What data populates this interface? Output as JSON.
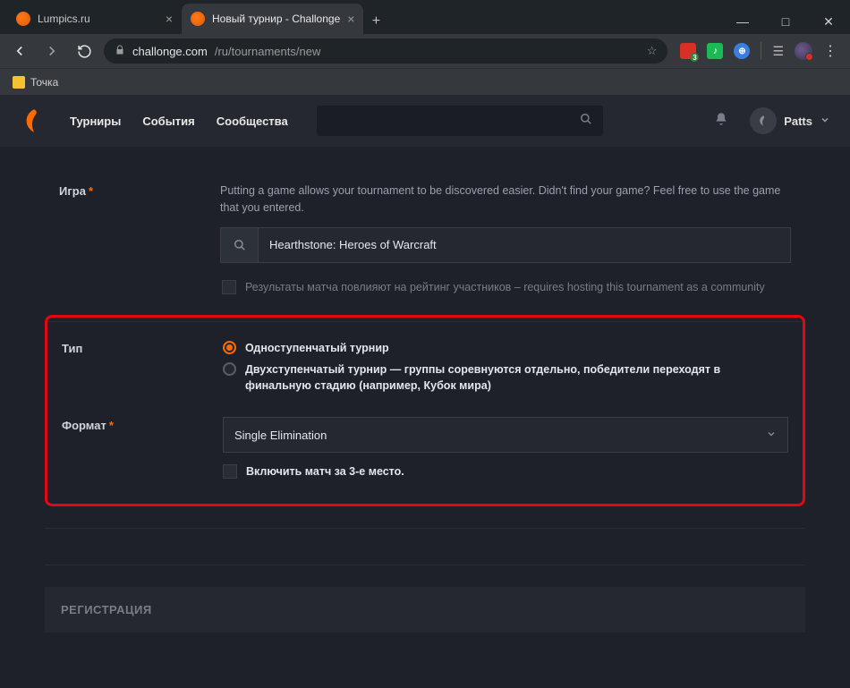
{
  "browser": {
    "tabs": [
      {
        "title": "Lumpics.ru"
      },
      {
        "title": "Новый турнир - Challonge"
      }
    ],
    "url_host": "challonge.com",
    "url_path": "/ru/tournaments/new",
    "bookmark": "Точка"
  },
  "nav": {
    "links": [
      "Турниры",
      "События",
      "Сообщества"
    ],
    "username": "Patts"
  },
  "form": {
    "game": {
      "label": "Игра",
      "hint": "Putting a game allows your tournament to be discovered easier. Didn't find your game? Feel free to use the game that you entered.",
      "value": "Hearthstone: Heroes of Warcraft",
      "ranking_check": "Результаты матча повлияют на рейтинг участников – requires hosting this tournament as a community"
    },
    "type": {
      "label": "Тип",
      "option1": "Одноступенчатый турнир",
      "option2": "Двухступенчатый турнир — группы соревнуются отдельно, победители переходят в финальную стадию (например, Кубок мира)"
    },
    "format": {
      "label": "Формат",
      "value": "Single Elimination",
      "third_place": "Включить матч за 3-е место."
    },
    "registration_header": "РЕГИСТРАЦИЯ"
  }
}
